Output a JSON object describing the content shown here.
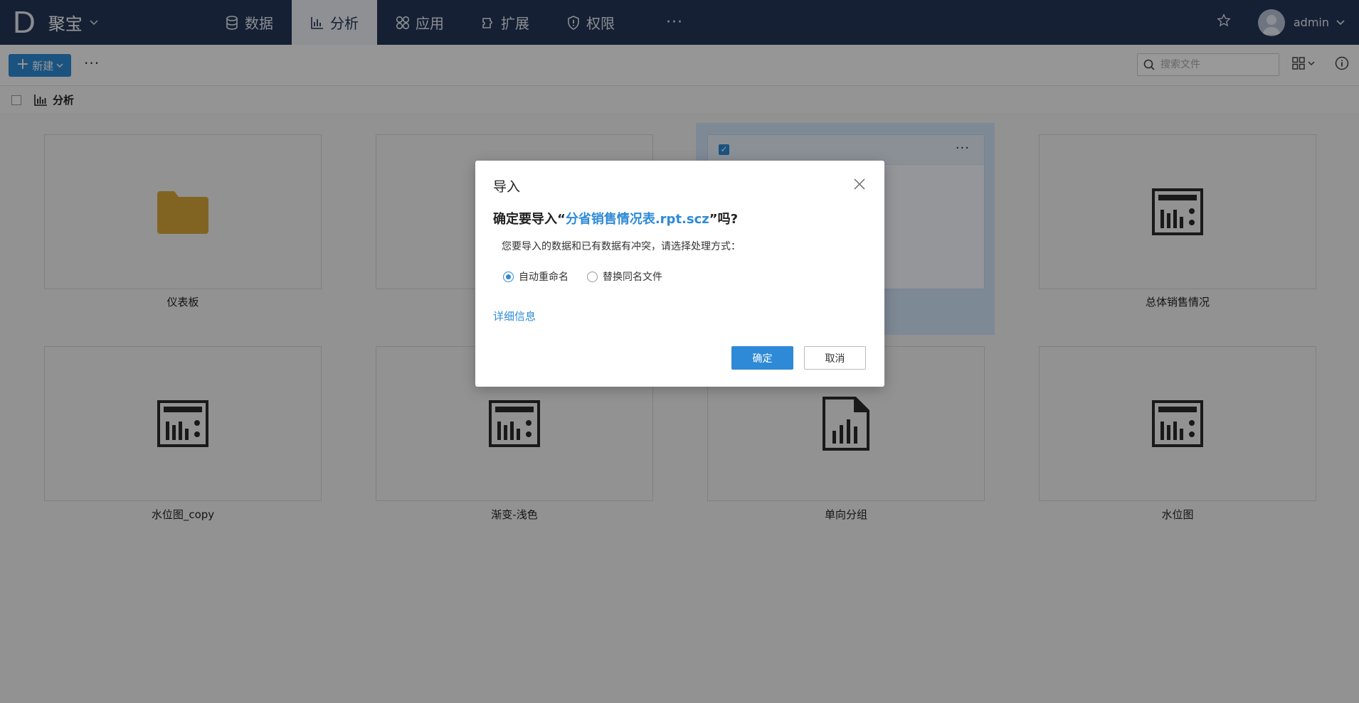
{
  "brand": {
    "logo": "D",
    "name": "聚宝"
  },
  "nav": {
    "items": [
      {
        "label": "数据"
      },
      {
        "label": "分析"
      },
      {
        "label": "应用"
      },
      {
        "label": "扩展"
      },
      {
        "label": "权限"
      }
    ],
    "active": "分析",
    "more": "···"
  },
  "user": {
    "name": "admin"
  },
  "toolbar": {
    "new_label": "新建",
    "more": "···",
    "search_placeholder": "搜索文件"
  },
  "breadcrumb": {
    "label": "分析"
  },
  "files": [
    {
      "label": "仪表板",
      "icon": "folder-icon"
    },
    {
      "label": "",
      "icon": "none"
    },
    {
      "label": "",
      "icon": "none",
      "selected": true
    },
    {
      "label": "总体销售情况",
      "icon": "report-icon"
    },
    {
      "label": "水位图_copy",
      "icon": "report-icon"
    },
    {
      "label": "渐变-浅色",
      "icon": "report-icon"
    },
    {
      "label": "单向分组",
      "icon": "chart-doc-icon"
    },
    {
      "label": "水位图",
      "icon": "report-icon"
    }
  ],
  "dialog": {
    "title": "导入",
    "question_prefix": "确定要导入“",
    "filename": "分省销售情况表.rpt.scz",
    "question_suffix": "”吗?",
    "description": "您要导入的数据和已有数据有冲突，请选择处理方式：",
    "options": [
      {
        "label": "自动重命名",
        "checked": true
      },
      {
        "label": "替换同名文件",
        "checked": false
      }
    ],
    "detail_link": "详细信息",
    "ok": "确定",
    "cancel": "取消"
  },
  "colors": {
    "nav_bg": "#233657",
    "accent": "#2e8ad6",
    "folder": "#d9a73a"
  }
}
